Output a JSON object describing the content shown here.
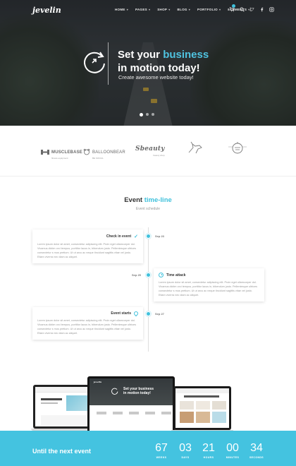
{
  "header": {
    "logo": "jevelin",
    "nav": [
      {
        "label": "HOME",
        "name": "nav-home"
      },
      {
        "label": "PAGES",
        "name": "nav-pages"
      },
      {
        "label": "SHOP",
        "name": "nav-shop"
      },
      {
        "label": "BLOG",
        "name": "nav-blog"
      },
      {
        "label": "PORTFOLIO",
        "name": "nav-portfolio"
      },
      {
        "label": "ELEMENTS",
        "name": "nav-elements"
      }
    ],
    "icons": [
      "cart-icon",
      "search-icon",
      "twitter-icon",
      "facebook-icon",
      "instagram-icon"
    ]
  },
  "hero": {
    "title_line1_prefix": "Set your ",
    "title_line1_accent": "business",
    "title_line2": "in motion today!",
    "subtitle": "Create awesome website today!",
    "slides": 3,
    "active_slide": 1
  },
  "brands": [
    {
      "name": "MUSCLEBASE",
      "sub": "fitness equipment"
    },
    {
      "name": "BALLOONBEAR",
      "sub": "BE SOCIAL"
    },
    {
      "name": "Sbeauty",
      "sub": "beauty shop"
    },
    {
      "name": "",
      "sub": ""
    },
    {
      "name": "HOT FRIES",
      "sub": ""
    }
  ],
  "events": {
    "title_prefix": "Event ",
    "title_accent": "time-line",
    "subtitle": "Event schedule",
    "items": [
      {
        "title": "Check in event",
        "date": "Sep 23",
        "icon": "check-icon",
        "text": "Lorem ipsum dolor sit amet, consectetur adipiscing elit. Proin eget ullamcorper dol. Vivamus dictim orci tempus, porttitor lacus in, bibendum justo. Pellentesque ultrices consectetur s mus pretium. Ut ut arcu ac neque tincidunt sagittis vitae vel justo. Etiam viverra nec diam ac aliquet."
      },
      {
        "title": "Time attack",
        "date": "Sep 25",
        "icon": "clock-icon",
        "text": "Lorem ipsum dolor sit amet, consectetur adipiscing elit. Proin eget ullamcorper dol. Vivamus dictim orci tempus, porttitor lacus in, bibendum justo. Pellentesque ultrices consectetur s mus pretium. Ut ut arcu ac neque tincidunt sagittis vitae vel justo. Etiam viverra nec diam ac aliquet."
      },
      {
        "title": "Event starts",
        "date": "Sep 27",
        "icon": "pin-icon",
        "text": "Lorem ipsum dolor sit amet, consectetur adipiscing elit. Proin eget ullamcorper dol. Vivamus dictim orci tempus, porttitor lacus in, bibendum justo. Pellentesque ultrices consectetur s mus pretium. Ut ut arcu ac neque tincidunt sagittis vitae vel justo. Etiam viverra nec diam ac aliquet."
      }
    ]
  },
  "devices": {
    "mini_title_1": "Set your business",
    "mini_title_2": "in motion today!"
  },
  "countdown": {
    "title": "Until the next event",
    "units": [
      {
        "value": "67",
        "label": "WEEKS"
      },
      {
        "value": "03",
        "label": "DAYS"
      },
      {
        "value": "21",
        "label": "HOURS"
      },
      {
        "value": "00",
        "label": "MINUTES"
      },
      {
        "value": "34",
        "label": "SECONDS"
      }
    ]
  },
  "colors": {
    "accent": "#44c3e0",
    "dark": "#2e3336",
    "text": "#333333"
  }
}
